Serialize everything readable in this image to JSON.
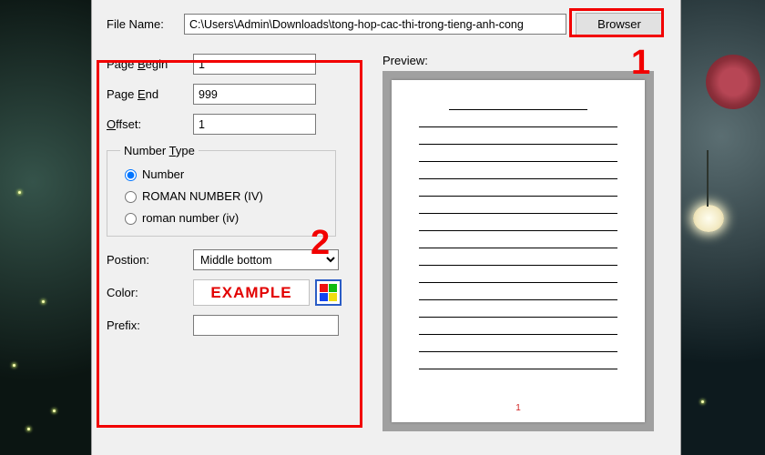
{
  "top": {
    "file_name_label": "File Name:",
    "file_name_value": "C:\\Users\\Admin\\Downloads\\tong-hop-cac-thi-trong-tieng-anh-cong",
    "browser_label": "Browser"
  },
  "left": {
    "page_begin_label": "Page Begin",
    "page_begin_value": "1",
    "page_end_label": "Page End",
    "page_end_value": "999",
    "offset_label": "Offset:",
    "offset_value": "1",
    "number_type_legend": "Number Type",
    "radio_number": "Number",
    "radio_roman_upper": "ROMAN NUMBER (IV)",
    "radio_roman_lower": "roman number (iv)",
    "position_label": "Postion:",
    "position_value": "Middle bottom",
    "color_label": "Color:",
    "example_text": "EXAMPLE",
    "prefix_label": "Prefix:",
    "prefix_value": ""
  },
  "right": {
    "preview_label": "Preview:",
    "page_number": "1"
  },
  "annotations": {
    "a1": "1",
    "a2": "2"
  }
}
